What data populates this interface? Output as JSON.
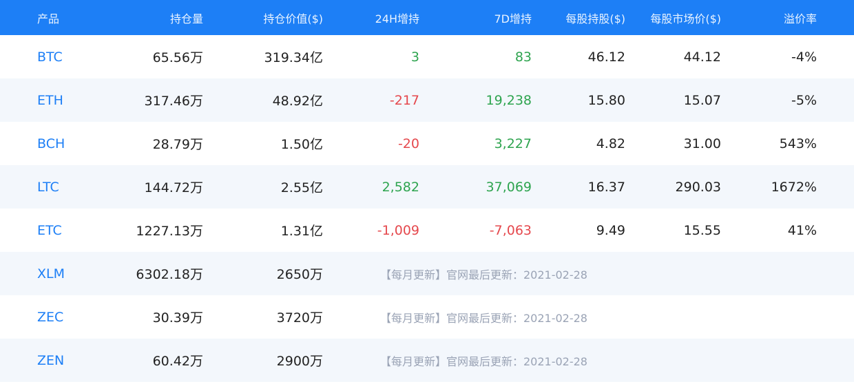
{
  "columns": {
    "name": "产品",
    "holdings": "持仓量",
    "holding_value": "持仓价值($)",
    "change_24h": "24H增持",
    "change_7d": "7D增持",
    "holding_per_share": "每股持股($)",
    "market_price_per_share": "每股市场价($)",
    "premium_rate": "溢价率"
  },
  "rows": [
    {
      "name": "BTC",
      "holdings": "65.56万",
      "holding_value": "319.34亿",
      "change_24h": "3",
      "change_7d": "83",
      "holding_per_share": "46.12",
      "market_price_per_share": "44.12",
      "premium_rate": "-4%"
    },
    {
      "name": "ETH",
      "holdings": "317.46万",
      "holding_value": "48.92亿",
      "change_24h": "-217",
      "change_7d": "19,238",
      "holding_per_share": "15.80",
      "market_price_per_share": "15.07",
      "premium_rate": "-5%"
    },
    {
      "name": "BCH",
      "holdings": "28.79万",
      "holding_value": "1.50亿",
      "change_24h": "-20",
      "change_7d": "3,227",
      "holding_per_share": "4.82",
      "market_price_per_share": "31.00",
      "premium_rate": "543%"
    },
    {
      "name": "LTC",
      "holdings": "144.72万",
      "holding_value": "2.55亿",
      "change_24h": "2,582",
      "change_7d": "37,069",
      "holding_per_share": "16.37",
      "market_price_per_share": "290.03",
      "premium_rate": "1672%"
    },
    {
      "name": "ETC",
      "holdings": "1227.13万",
      "holding_value": "1.31亿",
      "change_24h": "-1,009",
      "change_7d": "-7,063",
      "holding_per_share": "9.49",
      "market_price_per_share": "15.55",
      "premium_rate": "41%"
    },
    {
      "name": "XLM",
      "holdings": "6302.18万",
      "holding_value": "2650万",
      "note": "【每月更新】官网最后更新：2021-02-28"
    },
    {
      "name": "ZEC",
      "holdings": "30.39万",
      "holding_value": "3720万",
      "note": "【每月更新】官网最后更新：2021-02-28"
    },
    {
      "name": "ZEN",
      "holdings": "60.42万",
      "holding_value": "2900万",
      "note": "【每月更新】官网最后更新：2021-02-28"
    }
  ],
  "colors": {
    "header_bg": "#1d7ff6",
    "link": "#1d7ff6",
    "positive": "#2ea44f",
    "negative": "#e5484d",
    "row_alt": "#f3f7fc"
  }
}
